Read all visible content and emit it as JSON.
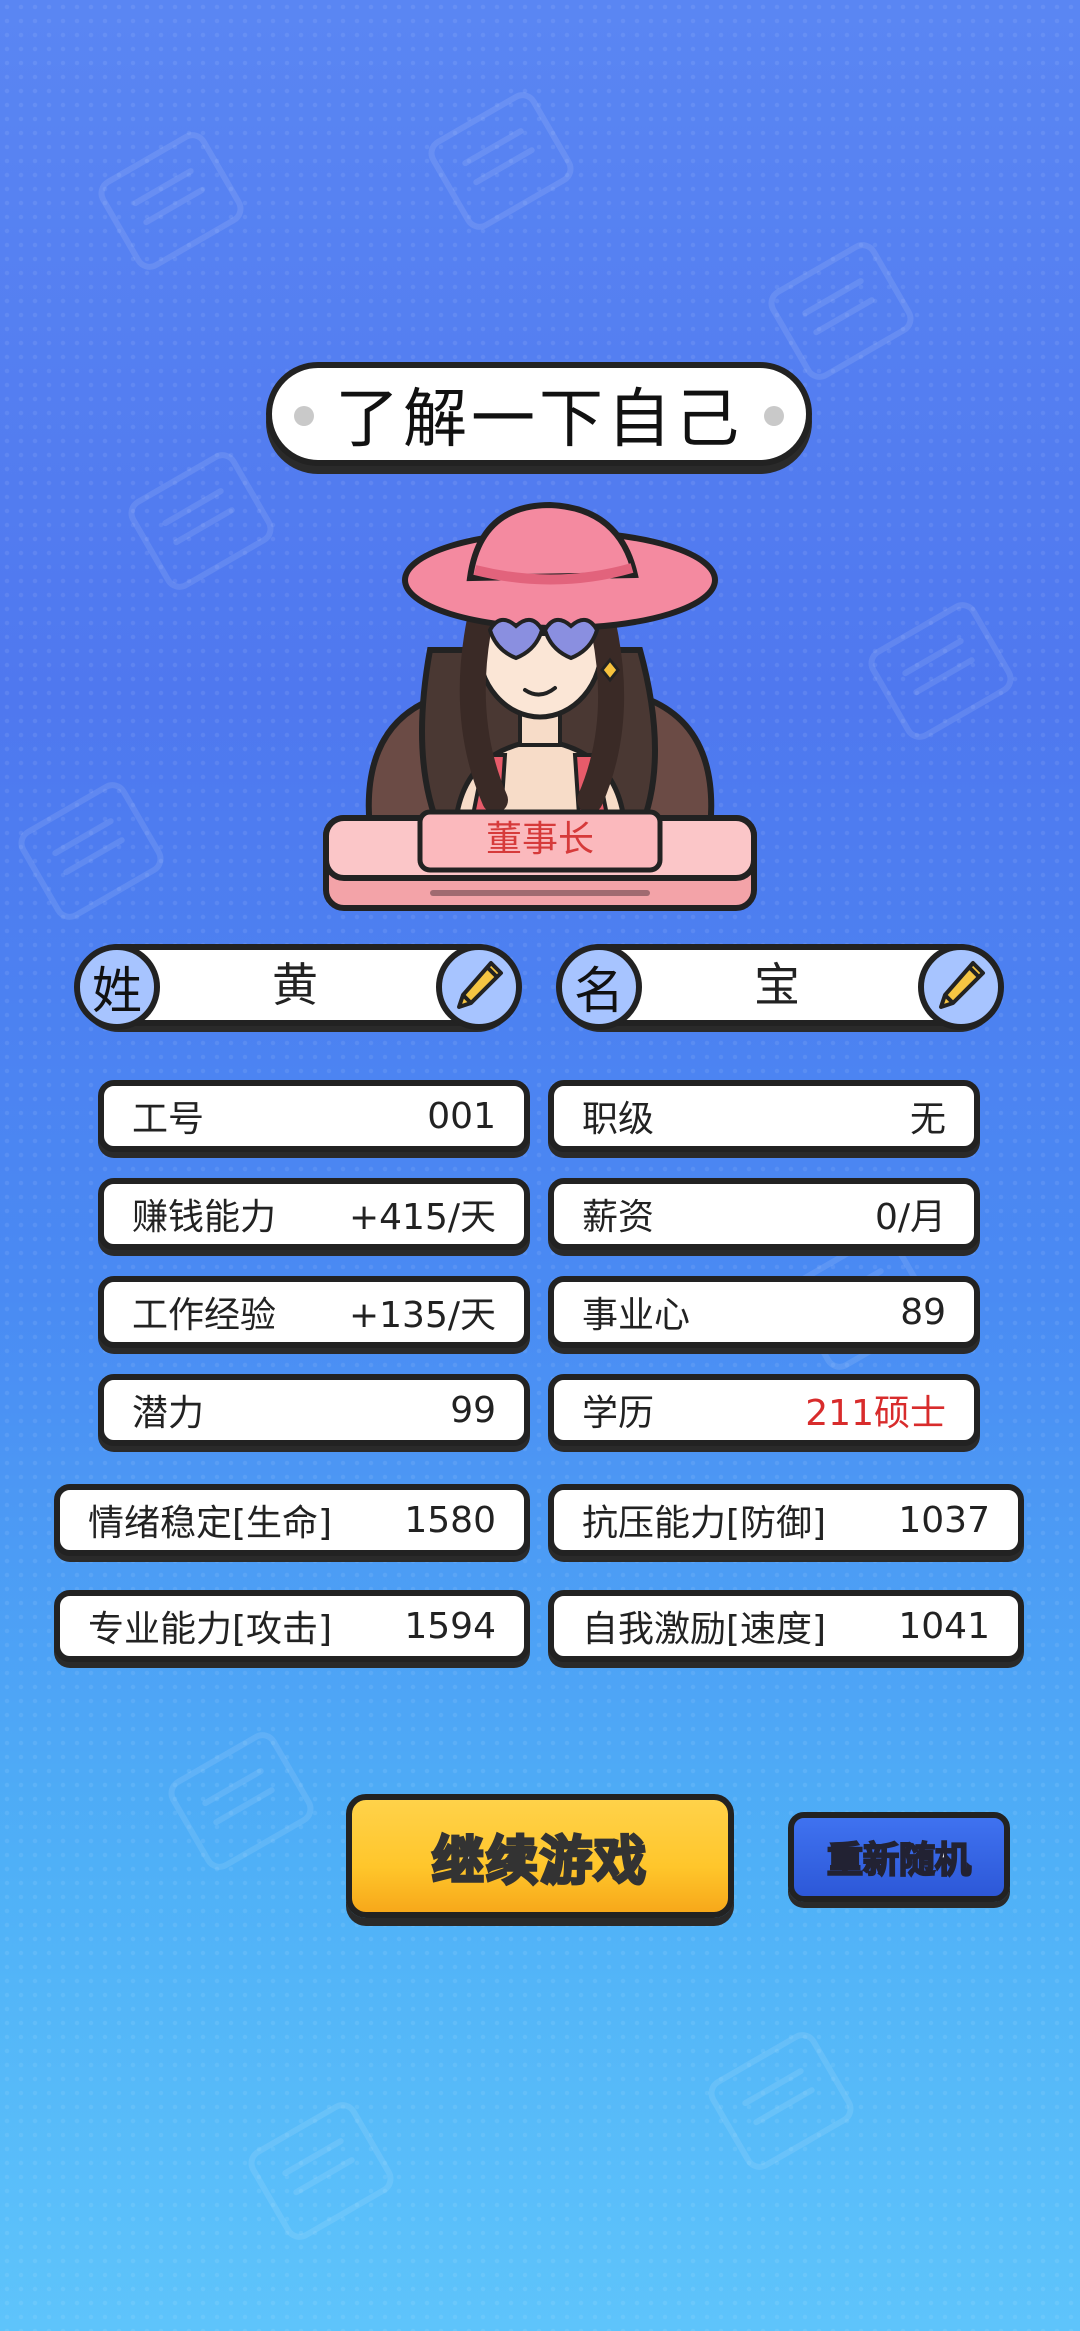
{
  "title": "了解一下自己",
  "role": "董事长",
  "name": {
    "surname_label": "姓",
    "surname_value": "黄",
    "given_label": "名",
    "given_value": "宝"
  },
  "stats": [
    {
      "label": "工号",
      "value": "001"
    },
    {
      "label": "职级",
      "value": "无"
    },
    {
      "label": "赚钱能力",
      "value": "+415/天"
    },
    {
      "label": "薪资",
      "value": "0/月"
    },
    {
      "label": "工作经验",
      "value": "+135/天"
    },
    {
      "label": "事业心",
      "value": "89"
    },
    {
      "label": "潜力",
      "value": "99"
    },
    {
      "label": "学历",
      "value": "211硕士",
      "color": "#d82c2c"
    }
  ],
  "attributes": [
    {
      "label": "情绪稳定[生命]",
      "value": "1580"
    },
    {
      "label": "抗压能力[防御]",
      "value": "1037"
    },
    {
      "label": "专业能力[攻击]",
      "value": "1594"
    },
    {
      "label": "自我激励[速度]",
      "value": "1041"
    }
  ],
  "buttons": {
    "continue_label": "继续游戏",
    "reroll_label": "重新随机"
  },
  "icons": {
    "edit": "pencil-icon"
  }
}
